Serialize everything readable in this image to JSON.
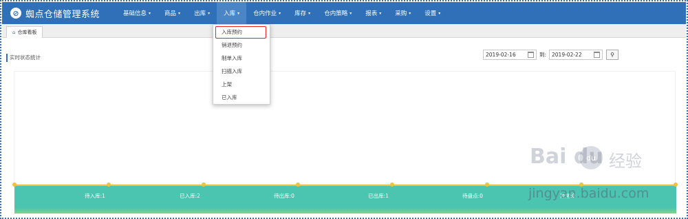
{
  "app": {
    "title": "蜘点仓储管理系统",
    "logo_glyph": "⊘"
  },
  "nav": [
    {
      "label": "基础信息"
    },
    {
      "label": "商品"
    },
    {
      "label": "出库"
    },
    {
      "label": "入库"
    },
    {
      "label": "仓内作业"
    },
    {
      "label": "库存"
    },
    {
      "label": "仓内策略"
    },
    {
      "label": "报表"
    },
    {
      "label": "采购"
    },
    {
      "label": "设置"
    }
  ],
  "tabs": [
    {
      "label": "仓库看板"
    }
  ],
  "section": {
    "title": "实时状态统计"
  },
  "filter": {
    "start_date": "2019-02-16",
    "separator": "到:",
    "end_date": "2019-02-22",
    "search_glyph": "🔍"
  },
  "dropdown": {
    "items": [
      "入库预约",
      "销退预约",
      "制单入库",
      "扫描入库",
      "上架",
      "已入库"
    ]
  },
  "stats": [
    {
      "label": "待入库:1"
    },
    {
      "label": "已入库:2"
    },
    {
      "label": "待出库:0"
    },
    {
      "label": "已出库:1"
    },
    {
      "label": "待盘点:0"
    },
    {
      "label": "异常:0"
    }
  ],
  "colors": {
    "brand": "#3070b8",
    "status_bar": "#4bc4b0",
    "highlight": "#e22222"
  },
  "watermark": {
    "logo": "Bai du",
    "cn": "经验",
    "url": "jingyan.baidu.com"
  }
}
